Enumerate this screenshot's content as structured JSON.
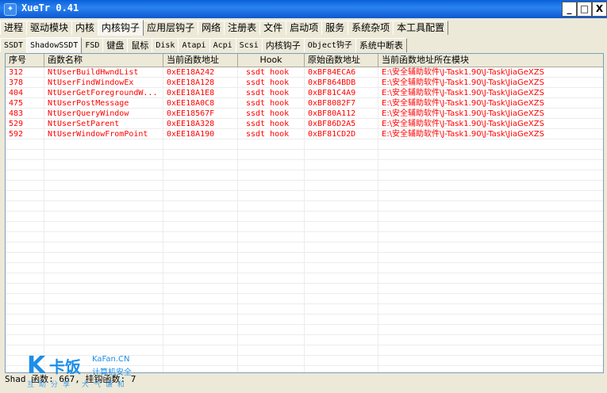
{
  "window": {
    "title": "XueTr 0.41",
    "min": "_",
    "max": "□",
    "close": "X"
  },
  "main_tabs": [
    "进程",
    "驱动模块",
    "内核",
    "内核钩子",
    "应用层钩子",
    "网络",
    "注册表",
    "文件",
    "启动项",
    "服务",
    "系统杂项",
    "本工具配置"
  ],
  "main_tabs_active": "内核钩子",
  "sub_tabs": [
    "SSDT",
    "ShadowSSDT",
    "FSD",
    "键盘",
    "鼠标",
    "Disk",
    "Atapi",
    "Acpi",
    "Scsi",
    "内核钩子",
    "Object钩子",
    "系统中断表"
  ],
  "sub_tabs_active": "ShadowSSDT",
  "columns": [
    "序号",
    "函数名称",
    "当前函数地址",
    "Hook",
    "原始函数地址",
    "当前函数地址所在模块"
  ],
  "rows": [
    {
      "index": "312",
      "name": "NtUserBuildHwndList",
      "current": "0xEE18A242",
      "hook": "ssdt hook",
      "original": "0xBF84ECA6",
      "module": "E:\\安全辅助软件\\J-Task1.90\\J-Task\\JiaGeXZS"
    },
    {
      "index": "378",
      "name": "NtUserFindWindowEx",
      "current": "0xEE18A128",
      "hook": "ssdt hook",
      "original": "0xBF864BDB",
      "module": "E:\\安全辅助软件\\J-Task1.90\\J-Task\\JiaGeXZS"
    },
    {
      "index": "404",
      "name": "NtUserGetForegroundW...",
      "current": "0xEE18A1E8",
      "hook": "ssdt hook",
      "original": "0xBF81C4A9",
      "module": "E:\\安全辅助软件\\J-Task1.90\\J-Task\\JiaGeXZS"
    },
    {
      "index": "475",
      "name": "NtUserPostMessage",
      "current": "0xEE18A0C8",
      "hook": "ssdt hook",
      "original": "0xBF8082F7",
      "module": "E:\\安全辅助软件\\J-Task1.90\\J-Task\\JiaGeXZS"
    },
    {
      "index": "483",
      "name": "NtUserQueryWindow",
      "current": "0xEE18567F",
      "hook": "ssdt hook",
      "original": "0xBF80A112",
      "module": "E:\\安全辅助软件\\J-Task1.90\\J-Task\\JiaGeXZS"
    },
    {
      "index": "529",
      "name": "NtUserSetParent",
      "current": "0xEE18A328",
      "hook": "ssdt hook",
      "original": "0xBF86D2A5",
      "module": "E:\\安全辅助软件\\J-Task1.90\\J-Task\\JiaGeXZS"
    },
    {
      "index": "592",
      "name": "NtUserWindowFromPoint",
      "current": "0xEE18A190",
      "hook": "ssdt hook",
      "original": "0xBF81CD2D",
      "module": "E:\\安全辅助软件\\J-Task1.90\\J-Task\\JiaGeXZS"
    }
  ],
  "status_text": "Shad    函数: 667,   挂钩函数: 7",
  "watermark": {
    "logo": "K",
    "brand": "卡饭",
    "site": "KaFan.CN",
    "sub": "计算机安全",
    "slogan": "互助分享 大气谦和"
  },
  "colors": {
    "hooked_row_text": "#ff0000",
    "titlebar": "#0a5fd8"
  }
}
